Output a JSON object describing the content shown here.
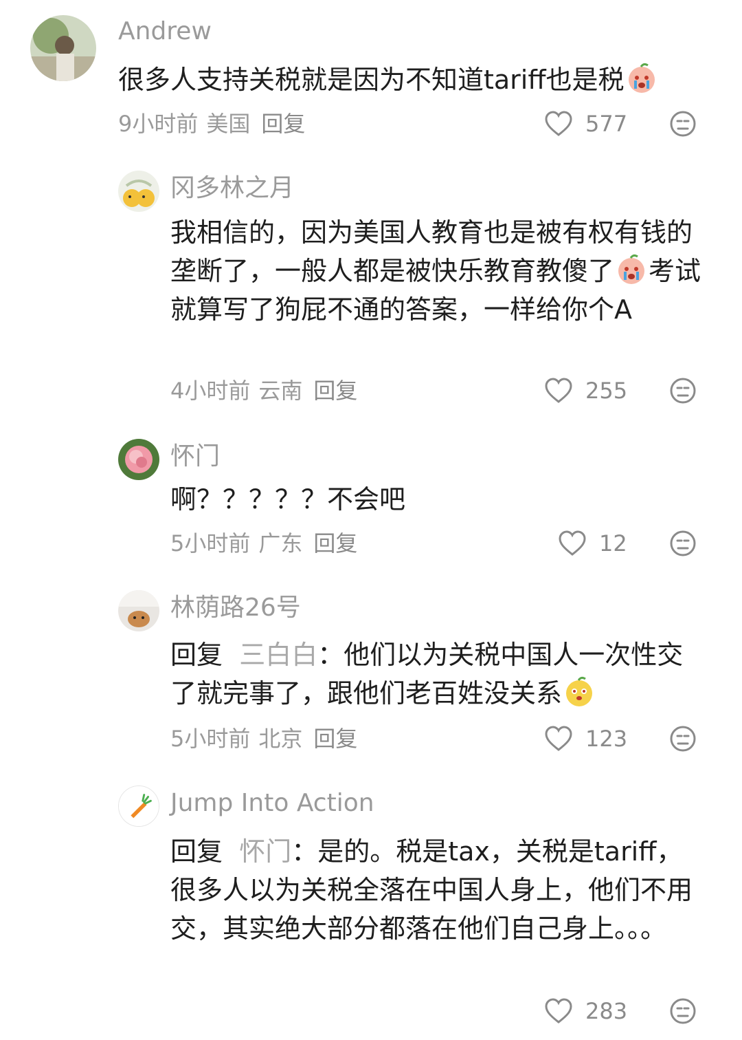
{
  "comments": [
    {
      "name": "Andrew",
      "text": "很多人支持关税就是因为不知道tariff也是税",
      "time": "9小时前",
      "location": "美国",
      "reply_label": "回复",
      "likes": "577"
    },
    {
      "name": "冈多林之月",
      "text_a": "我相信的，因为美国人教育也是被有权有钱的垄断了，一般人都是被快乐教育教傻了",
      "text_b": "考试就算写了狗屁不通的答案，一样给你个A",
      "time": "4小时前",
      "location": "云南",
      "reply_label": "回复",
      "likes": "255"
    },
    {
      "name": "怀门",
      "text": "啊？？？？？不会吧",
      "time": "5小时前",
      "location": "广东",
      "reply_label": "回复",
      "likes": "12"
    },
    {
      "name": "林荫路26号",
      "reply_prefix": "回复",
      "mention": "三白白",
      "text": "：他们以为关税中国人一次性交了就完事了，跟他们老百姓没关系",
      "time": "5小时前",
      "location": "北京",
      "reply_label": "回复",
      "likes": "123"
    },
    {
      "name": "Jump Into Action",
      "reply_prefix": "回复",
      "mention": "怀门",
      "text": "：是的。税是tax，关税是tariff，很多人以为关税全落在中国人身上，他们不用交，其实绝大部分都落在他们自己身上。。。",
      "likes": "283"
    }
  ]
}
